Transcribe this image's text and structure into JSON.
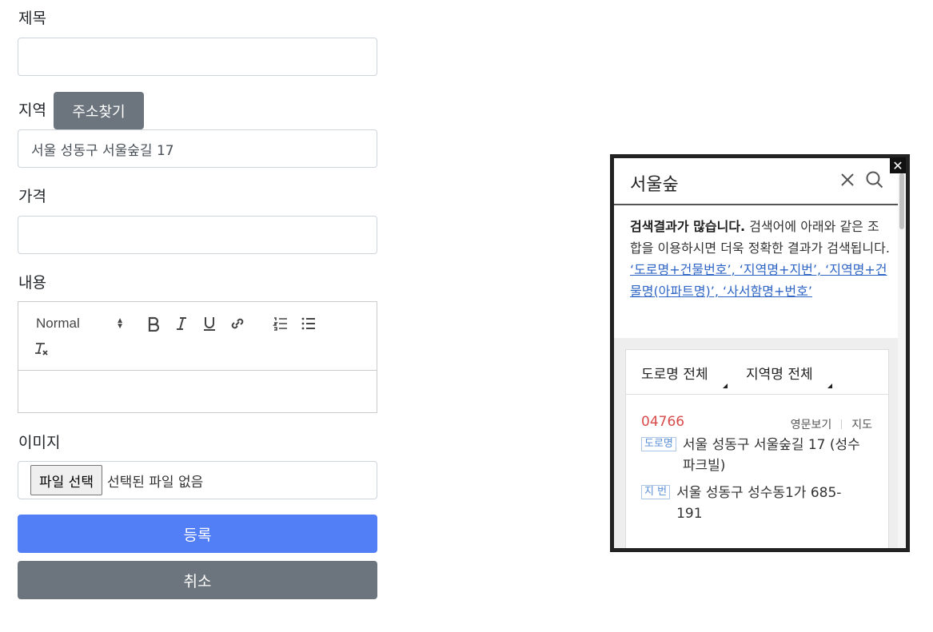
{
  "form": {
    "title_label": "제목",
    "title_value": "",
    "region_label": "지역",
    "address_search_button": "주소찾기",
    "region_value": "서울 성동구 서울숲길 17",
    "price_label": "가격",
    "price_value": "",
    "content_label": "내용",
    "editor": {
      "format_select": "Normal",
      "content": ""
    },
    "image_label": "이미지",
    "file_button": "파일 선택",
    "file_status": "선택된 파일 없음",
    "submit_button": "등록",
    "cancel_button": "취소"
  },
  "popup": {
    "search_query": "서울숲",
    "notice_bold": "검색결과가 많습니다.",
    "notice_text": "검색어에 아래와 같은 조합을 이용하시면 더욱 정확한 결과가 검색됩니다.",
    "tips": "‘도로명+건물번호’, ‘지역명+지번’, ‘지역명+건물명(아파트명)’, ‘사서함명+번호’",
    "filter_road": "도로명 전체",
    "filter_region": "지역명 전체",
    "result": {
      "zipcode": "04766",
      "link_english": "영문보기",
      "link_map": "지도",
      "road_badge": "도로명",
      "road_address": "서울 성동구 서울숲길 17 (성수파크빌)",
      "jibun_badge": "지 번",
      "jibun_address": "서울 성동구 성수동1가 685-191"
    }
  }
}
